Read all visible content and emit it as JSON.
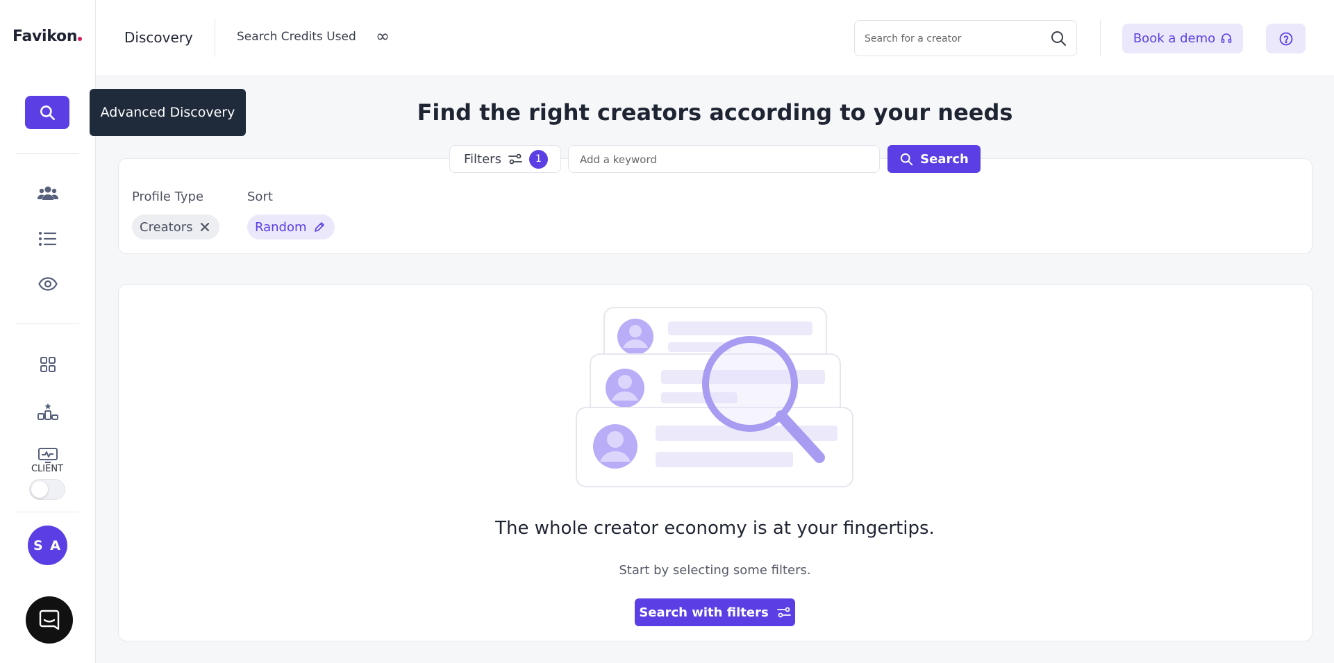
{
  "app": {
    "logo": "Favikon",
    "brand_color": "#5b3fe4",
    "logo_dot_color": "#d81b60"
  },
  "header": {
    "title": "Discovery",
    "credits_label": "Search Credits Used",
    "credits_value": "∞",
    "search_placeholder": "Search for a creator",
    "book_demo": "Book a demo"
  },
  "sidebar": {
    "tooltip": "Advanced Discovery",
    "client_label": "CLIENT",
    "avatar_initials": "S A",
    "icons": [
      "search-icon",
      "users-icon",
      "list-icon",
      "eye-icon",
      "grid-icon",
      "ranking-icon",
      "monitor-icon"
    ]
  },
  "main": {
    "heading": "Find the right creators according to your needs",
    "filters_label": "Filters",
    "filters_count": "1",
    "keyword_placeholder": "Add a keyword",
    "search_button": "Search",
    "profile_type_label": "Profile Type",
    "profile_type_value": "Creators",
    "sort_label": "Sort",
    "sort_value": "Random"
  },
  "empty_state": {
    "title": "The whole creator economy is at your fingertips.",
    "subtitle": "Start by selecting some filters.",
    "button": "Search with filters"
  }
}
